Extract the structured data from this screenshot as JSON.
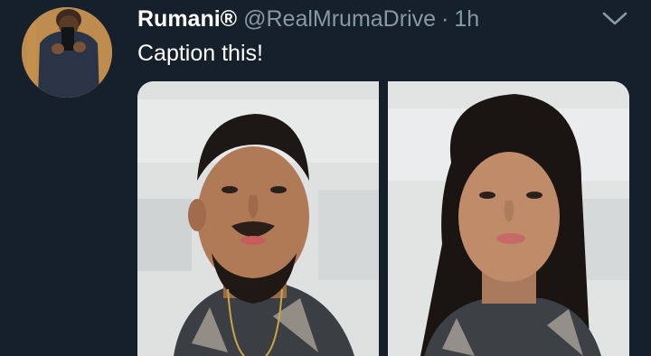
{
  "tweet": {
    "display_name": "Rumani®",
    "handle": "@RealMrumaDrive",
    "separator": "·",
    "timestamp": "1h",
    "text": "Caption this!"
  },
  "icons": {
    "menu": "chevron-down-icon"
  },
  "colors": {
    "background": "#15202b",
    "primary_text": "#ffffff",
    "secondary_text": "#8899a6"
  },
  "media": {
    "photo_count": 2
  }
}
